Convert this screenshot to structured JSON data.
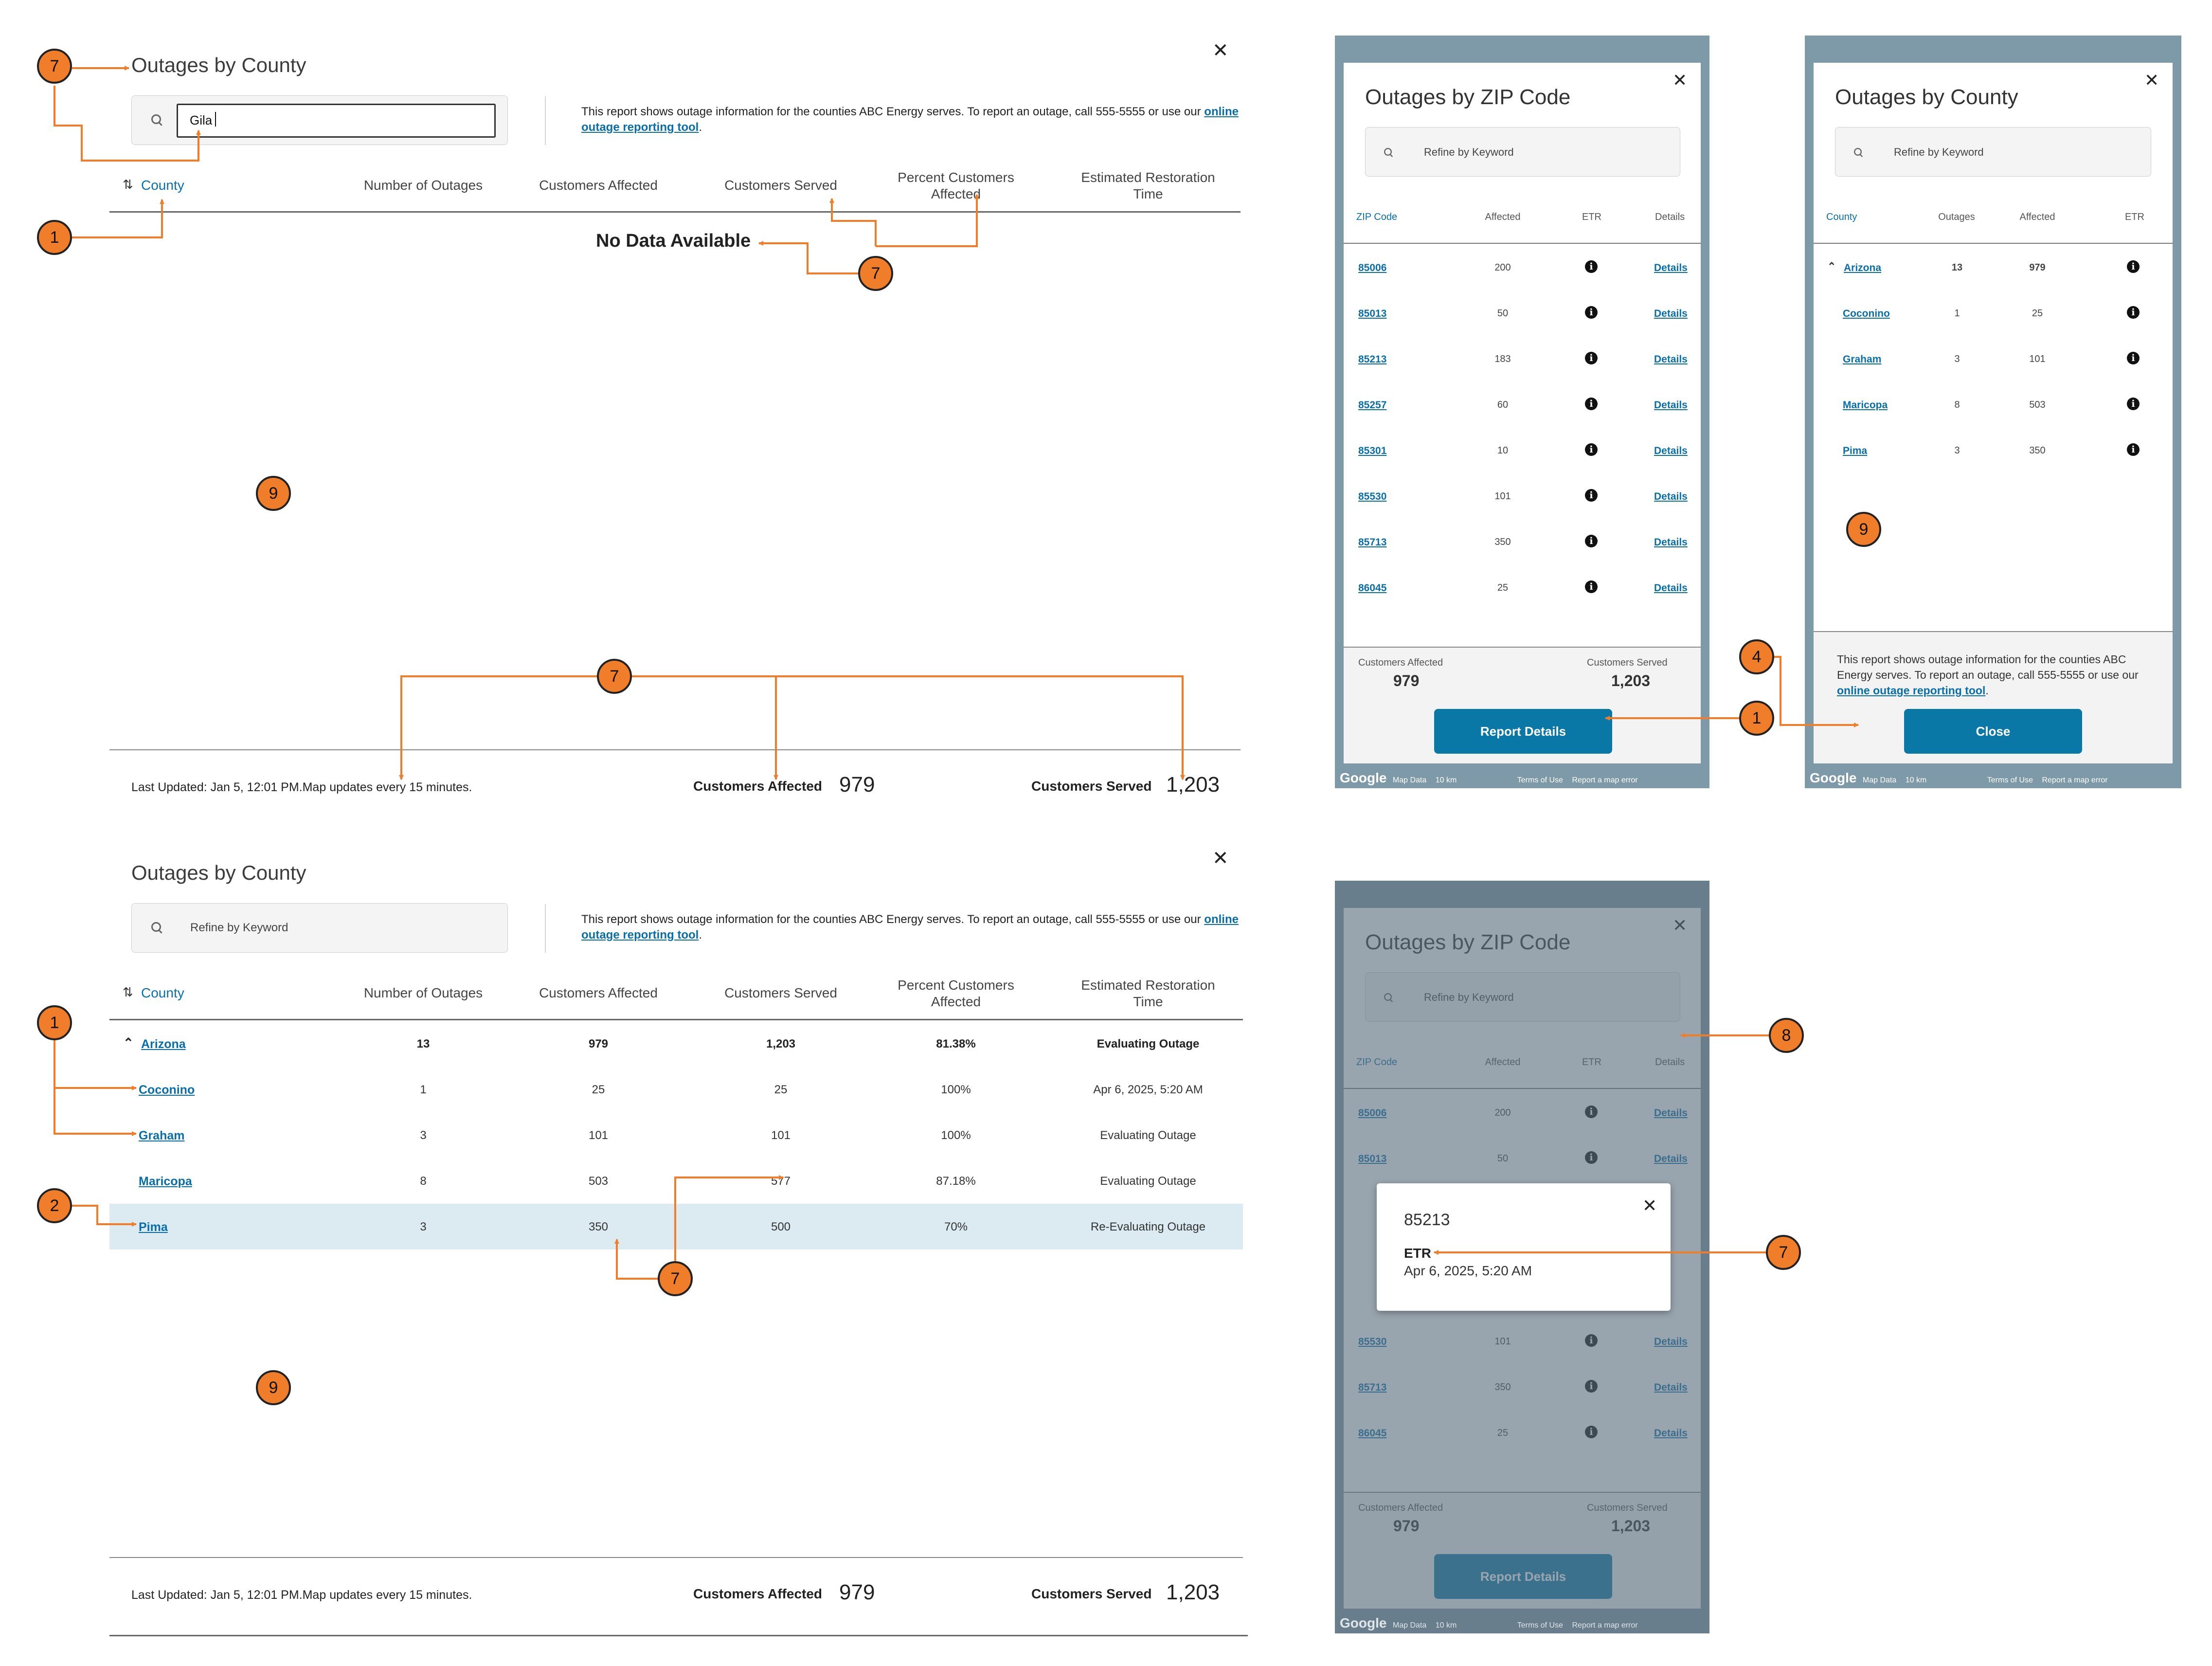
{
  "desktop_county": {
    "title": "Outages by County",
    "search_value": "Gila",
    "search_placeholder": "Refine by Keyword",
    "description_text": "This report shows outage information for the counties ABC Energy serves. To report an outage, call 555-5555 or use our ",
    "description_link": "online outage reporting tool",
    "description_end": ".",
    "columns": [
      "County",
      "Number of Outages",
      "Customers Affected",
      "Customers Served",
      "Percent Customers Affected",
      "Estimated Restoration Time"
    ],
    "no_data": "No Data Available",
    "footer": {
      "last_updated": "Last Updated: Jan 5, 12:01 PM.Map updates every 15 minutes.",
      "affected_label": "Customers Affected",
      "affected_value": "979",
      "served_label": "Customers Served",
      "served_value": "1,203"
    },
    "rows": [
      {
        "county": "Arizona",
        "outages": "13",
        "affected": "979",
        "served": "1,203",
        "percent": "81.38%",
        "etr": "Evaluating Outage"
      },
      {
        "county": "Coconino",
        "outages": "1",
        "affected": "25",
        "served": "25",
        "percent": "100%",
        "etr": "Apr 6, 2025, 5:20 AM"
      },
      {
        "county": "Graham",
        "outages": "3",
        "affected": "101",
        "served": "101",
        "percent": "100%",
        "etr": "Evaluating Outage"
      },
      {
        "county": "Maricopa",
        "outages": "8",
        "affected": "503",
        "served": "577",
        "percent": "87.18%",
        "etr": "Evaluating Outage"
      },
      {
        "county": "Pima",
        "outages": "3",
        "affected": "350",
        "served": "500",
        "percent": "70%",
        "etr": "Re-Evaluating Outage"
      }
    ]
  },
  "mobile_zip": {
    "title": "Outages by ZIP Code",
    "search_placeholder": "Refine by Keyword",
    "columns": [
      "ZIP Code",
      "Affected",
      "ETR",
      "Details"
    ],
    "rows": [
      {
        "zip": "85006",
        "affected": "200",
        "details": "Details"
      },
      {
        "zip": "85013",
        "affected": "50",
        "details": "Details"
      },
      {
        "zip": "85213",
        "affected": "183",
        "details": "Details"
      },
      {
        "zip": "85257",
        "affected": "60",
        "details": "Details"
      },
      {
        "zip": "85301",
        "affected": "10",
        "details": "Details"
      },
      {
        "zip": "85530",
        "affected": "101",
        "details": "Details"
      },
      {
        "zip": "85713",
        "affected": "350",
        "details": "Details"
      },
      {
        "zip": "86045",
        "affected": "25",
        "details": "Details"
      }
    ],
    "footer": {
      "affected_label": "Customers Affected",
      "affected_value": "979",
      "served_label": "Customers Served",
      "served_value": "1,203"
    },
    "button": "Report Details"
  },
  "mobile_county": {
    "title": "Outages by County",
    "search_placeholder": "Refine by Keyword",
    "columns": [
      "County",
      "Outages",
      "Affected",
      "ETR"
    ],
    "rows": [
      {
        "county": "Arizona",
        "outages": "13",
        "affected": "979"
      },
      {
        "county": "Coconino",
        "outages": "1",
        "affected": "25"
      },
      {
        "county": "Graham",
        "outages": "3",
        "affected": "101"
      },
      {
        "county": "Maricopa",
        "outages": "8",
        "affected": "503"
      },
      {
        "county": "Pima",
        "outages": "3",
        "affected": "350"
      }
    ],
    "description_text": "This report shows outage information for the counties ABC Energy serves. To report an outage, call 555-5555 or use our ",
    "description_link": "online outage reporting tool",
    "button": "Close"
  },
  "etr_popup": {
    "zip": "85213",
    "label": "ETR",
    "value": "Apr 6, 2025, 5:20 AM"
  },
  "map_footer": {
    "google": "Google",
    "map_data": "Map Data",
    "scale": "10 km",
    "terms": "Terms of Use",
    "report": "Report a map error"
  },
  "callouts": [
    "1",
    "2",
    "4",
    "7",
    "8",
    "9"
  ]
}
